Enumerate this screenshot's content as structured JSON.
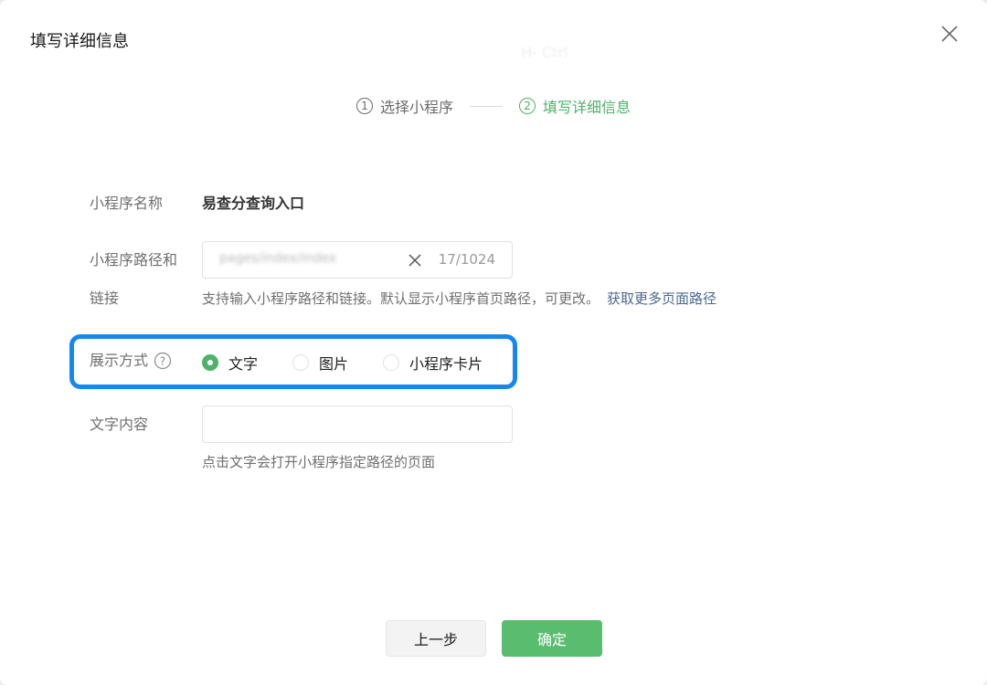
{
  "dialog": {
    "title": "填写详细信息",
    "ghost_text": "H- Ctrl"
  },
  "steps": [
    {
      "num": "1",
      "label": "选择小程序",
      "active": false
    },
    {
      "num": "2",
      "label": "填写详细信息",
      "active": true
    }
  ],
  "form": {
    "name_label": "小程序名称",
    "name_value": "易查分查询入口",
    "path_label_line1": "小程序路径和",
    "path_label_line2": "链接",
    "path_value": "pages/index/index",
    "path_counter": "17/1024",
    "path_hint": "支持输入小程序路径和链接。默认显示小程序首页路径，可更改。",
    "path_hint_link": "获取更多页面路径",
    "display_label": "展示方式",
    "display_options": [
      {
        "label": "文字",
        "checked": true
      },
      {
        "label": "图片",
        "checked": false
      },
      {
        "label": "小程序卡片",
        "checked": false
      }
    ],
    "text_label": "文字内容",
    "text_value": "",
    "text_hint": "点击文字会打开小程序指定路径的页面"
  },
  "buttons": {
    "prev": "上一步",
    "confirm": "确定"
  },
  "colors": {
    "accent_green": "#4fb26a",
    "highlight_blue": "#1588f0",
    "link_blue": "#4a6790"
  }
}
